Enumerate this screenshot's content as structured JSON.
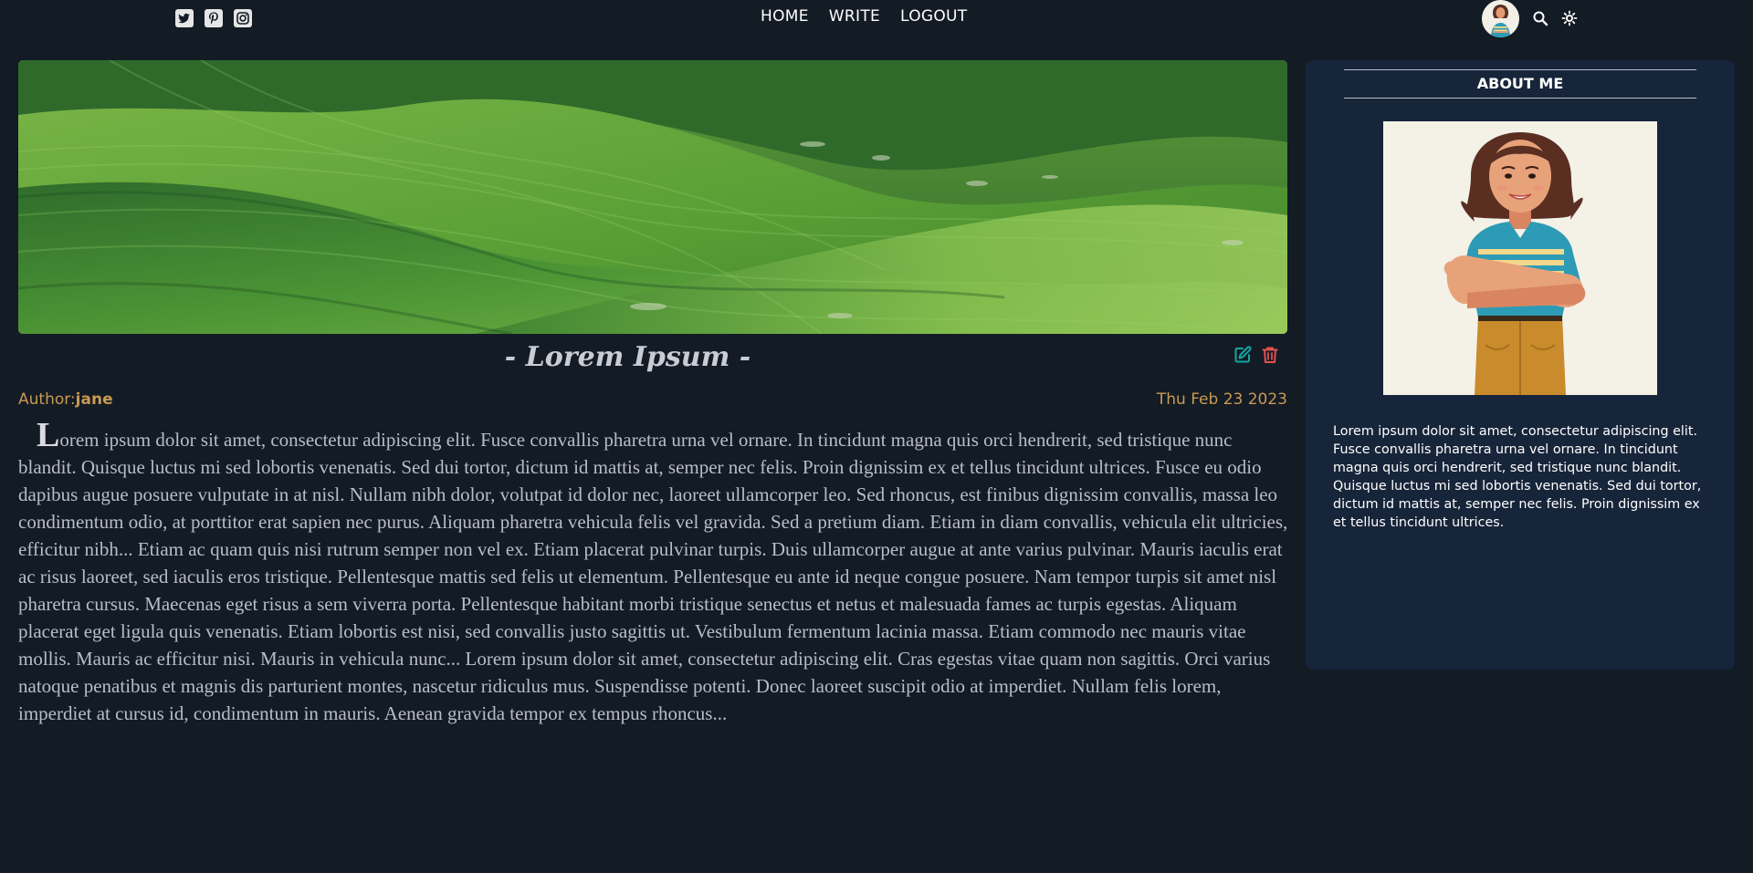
{
  "social": {
    "icons": [
      "twitter-icon",
      "pinterest-icon",
      "instagram-icon"
    ]
  },
  "nav": {
    "home": "HOME",
    "write": "WRITE",
    "logout": "LOGOUT"
  },
  "toolbar": {
    "icons": [
      "avatar",
      "search-icon",
      "theme-toggle-icon"
    ]
  },
  "post": {
    "title": "- Lorem Ipsum -",
    "author_label": "Author:",
    "author_name": "jane",
    "date": "Thu Feb 23 2023",
    "dropcap": "L",
    "body": "orem ipsum dolor sit amet, consectetur adipiscing elit. Fusce convallis pharetra urna vel ornare. In tincidunt magna quis orci hendrerit, sed tristique nunc blandit. Quisque luctus mi sed lobortis venenatis. Sed dui tortor, dictum id mattis at, semper nec felis. Proin dignissim ex et tellus tincidunt ultrices. Fusce eu odio dapibus augue posuere vulputate in at nisl. Nullam nibh dolor, volutpat id dolor nec, laoreet ullamcorper leo. Sed rhoncus, est finibus dignissim convallis, massa leo condimentum odio, at porttitor erat sapien nec purus. Aliquam pharetra vehicula felis vel gravida. Sed a pretium diam. Etiam in diam convallis, vehicula elit ultricies, efficitur nibh... Etiam ac quam quis nisi rutrum semper non vel ex. Etiam placerat pulvinar turpis. Duis ullamcorper augue at ante varius pulvinar. Mauris iaculis erat ac risus laoreet, sed iaculis eros tristique. Pellentesque mattis sed felis ut elementum. Pellentesque eu ante id neque congue posuere. Nam tempor turpis sit amet nisl pharetra cursus. Maecenas eget risus a sem viverra porta. Pellentesque habitant morbi tristique senectus et netus et malesuada fames ac turpis egestas. Aliquam placerat eget ligula quis venenatis. Etiam lobortis est nisi, sed convallis justo sagittis ut. Vestibulum fermentum lacinia massa. Etiam commodo nec mauris vitae mollis. Mauris ac efficitur nisi. Mauris in vehicula nunc... Lorem ipsum dolor sit amet, consectetur adipiscing elit. Cras egestas vitae quam non sagittis. Orci varius natoque penatibus et magnis dis parturient montes, nascetur ridiculus mus. Suspendisse potenti. Donec laoreet suscipit odio at imperdiet. Nullam felis lorem, imperdiet at cursus id, condimentum in mauris. Aenean gravida tempor ex tempus rhoncus...",
    "action_icons": [
      "edit-icon",
      "delete-icon"
    ]
  },
  "sidebar": {
    "title": "ABOUT ME",
    "text": "Lorem ipsum dolor sit amet, consectetur adipiscing elit. Fusce convallis pharetra urna vel ornare. In tincidunt magna quis orci hendrerit, sed tristique nunc blandit. Quisque luctus mi sed lobortis venenatis. Sed dui tortor, dictum id mattis at, semper nec felis. Proin dignissim ex et tellus tincidunt ultrices."
  },
  "colors": {
    "background": "#131b25",
    "sidebar": "#17253a",
    "meta": "#c99a52",
    "edit": "#16a5a0",
    "delete": "#e0524f"
  }
}
